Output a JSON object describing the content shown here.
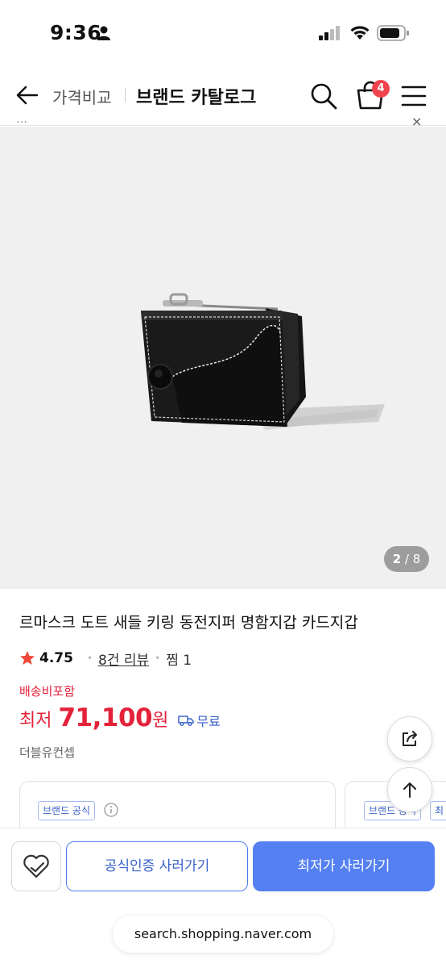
{
  "status_bar": {
    "time": "9:36"
  },
  "header": {
    "breadcrumb": "가격비교",
    "title": "브랜드 카탈로그",
    "cart_count": "4"
  },
  "notice": {
    "text_pre": "…",
    "text_highlight": "",
    "close": "×"
  },
  "product": {
    "image_counter_current": "2",
    "image_counter_total": "8",
    "name": "르마스크 도트 새들 키링 동전지퍼 명함지갑 카드지갑",
    "rating": "4.75",
    "review_link": "8건 리뷰",
    "wish": "찜 1",
    "shipping_label": "배송비포함",
    "price_prefix": "최저",
    "price": "71,100",
    "price_unit": "원",
    "free_shipping": "무료",
    "seller": "더블유컨셉"
  },
  "offers": [
    {
      "tag": "브랜드 공식"
    },
    {
      "tag": "브랜드 공식",
      "tag2": "최"
    }
  ],
  "bottom_bar": {
    "official_button": "공식인증 사러가기",
    "lowest_button": "최저가 사러가기"
  },
  "browser": {
    "url": "search.shopping.naver.com"
  },
  "colors": {
    "accent_red": "#e4223a",
    "accent_blue": "#5580f1",
    "badge": "#f0434e"
  }
}
